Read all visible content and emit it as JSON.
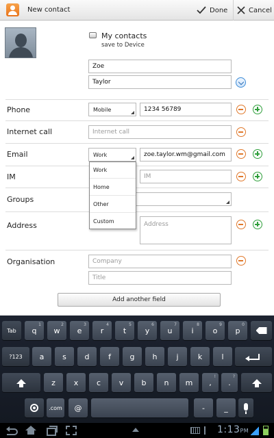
{
  "titlebar": {
    "title": "New contact",
    "done_label": "Done",
    "cancel_label": "Cancel"
  },
  "account": {
    "name": "My contacts",
    "sub": "save to Device"
  },
  "name": {
    "first": "Zoe",
    "last": "Taylor"
  },
  "phone": {
    "label": "Phone",
    "type": "Mobile",
    "value": "1234 56789"
  },
  "internet_call": {
    "label": "Internet call",
    "placeholder": "Internet call"
  },
  "email": {
    "label": "Email",
    "type": "Work",
    "value": "zoe.taylor.wm@gmail.com"
  },
  "email_type_options": [
    "Work",
    "Home",
    "Other",
    "Custom"
  ],
  "im": {
    "label": "IM",
    "placeholder": "IM"
  },
  "groups": {
    "label": "Groups"
  },
  "address": {
    "label": "Address",
    "placeholder": "Address"
  },
  "organisation": {
    "label": "Organisation",
    "company_placeholder": "Company",
    "title_placeholder": "Title"
  },
  "add_field_label": "Add another field",
  "keyboard": {
    "row1": [
      "Tab",
      "q",
      "w",
      "e",
      "r",
      "t",
      "y",
      "u",
      "i",
      "o",
      "p"
    ],
    "row1_sub": [
      "1",
      "2",
      "3",
      "4",
      "5",
      "6",
      "7",
      "8",
      "9",
      "0"
    ],
    "row2": [
      "?123",
      "a",
      "s",
      "d",
      "f",
      "g",
      "h",
      "j",
      "k",
      "l"
    ],
    "row3": [
      "z",
      "x",
      "c",
      "v",
      "b",
      "n",
      "m",
      ",",
      "."
    ],
    "row3_sub": [
      "!",
      "?"
    ],
    "row4": [
      ".com",
      "@",
      "-",
      "_"
    ]
  },
  "statusbar": {
    "time": "1:13",
    "ampm": "PM"
  },
  "colors": {
    "accent": "#3b8ad6",
    "remove": "#e0782a",
    "add": "#2e9e3a",
    "keyboard_bg": "#1a202b"
  }
}
